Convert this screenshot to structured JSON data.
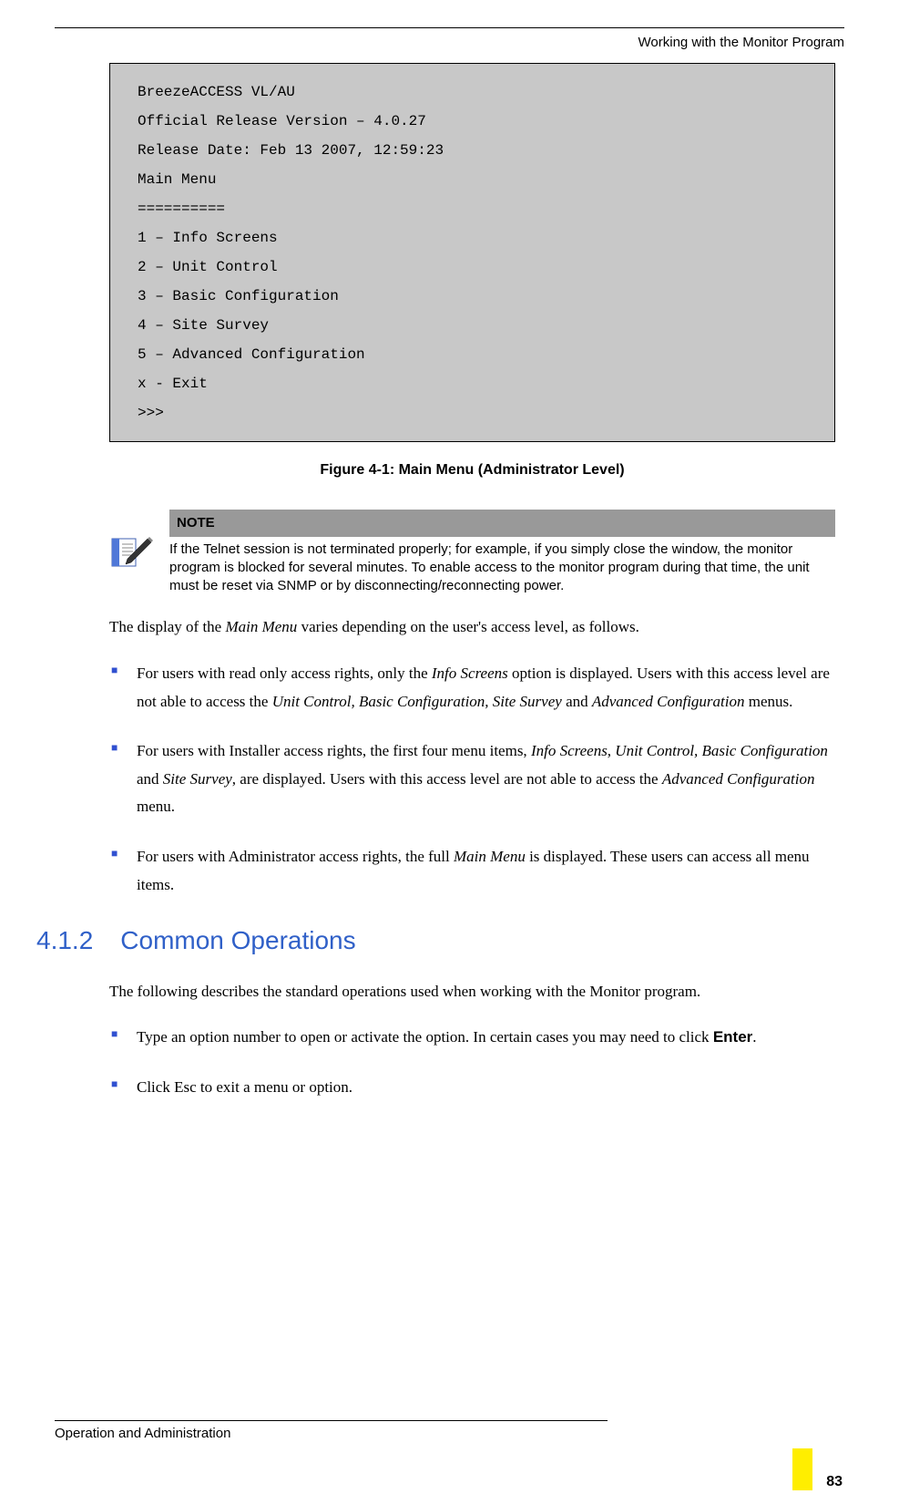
{
  "header": {
    "running_title": "Working with the Monitor Program"
  },
  "terminal": {
    "lines": [
      "BreezeACCESS VL/AU",
      "Official Release Version – 4.0.27",
      "Release Date: Feb 13 2007, 12:59:23",
      "Main Menu",
      "==========",
      "1 –  Info Screens",
      "2 – Unit Control",
      "3 –  Basic Configuration",
      "4 – Site Survey",
      "5 – Advanced Configuration",
      "x - Exit",
      ">>>"
    ]
  },
  "figure_caption": "Figure 4-1: Main Menu (Administrator Level)",
  "note": {
    "label": "NOTE",
    "text": "If the Telnet session is not terminated properly; for example, if you simply close the window, the monitor program is blocked for several minutes. To enable access to the monitor program during that time, the unit must be reset via SNMP or by disconnecting/reconnecting power."
  },
  "body": {
    "intro_pre": "The display of the ",
    "intro_em": "Main Menu",
    "intro_post": " varies depending on the user's access level, as follows.",
    "bullets": [
      {
        "parts": [
          {
            "t": " For users with read only access rights, only the "
          },
          {
            "t": "Info Screens",
            "em": true
          },
          {
            "t": " option is displayed. Users with this access level are not able to access the "
          },
          {
            "t": "Unit Control, Basic Configuration, Site Survey",
            "em": true
          },
          {
            "t": " and "
          },
          {
            "t": "Advanced Configuration",
            "em": true
          },
          {
            "t": " menus."
          }
        ]
      },
      {
        "parts": [
          {
            "t": " For users with Installer access rights, the first four menu items, "
          },
          {
            "t": "Info Screens, Unit Control, Basic Configuration",
            "em": true
          },
          {
            "t": " and "
          },
          {
            "t": "Site Survey",
            "em": true
          },
          {
            "t": ", are displayed. Users with this access level are not able to access the "
          },
          {
            "t": "Advanced Configuration",
            "em": true
          },
          {
            "t": " menu."
          }
        ]
      },
      {
        "parts": [
          {
            "t": " For users with Administrator access rights, the full "
          },
          {
            "t": "Main Menu",
            "em": true
          },
          {
            "t": " is displayed. These users can access all menu items."
          }
        ]
      }
    ]
  },
  "section": {
    "num": "4.1.2",
    "title": "Common Operations",
    "intro": "The following describes the standard operations used when working with the Monitor program.",
    "bullets": [
      {
        "parts": [
          {
            "t": " Type an option number to open or activate the option. In certain cases you may need to click "
          },
          {
            "t": "Enter",
            "bold": true
          },
          {
            "t": "."
          }
        ]
      },
      {
        "parts": [
          {
            "t": " Click Esc to exit a menu or option."
          }
        ]
      }
    ]
  },
  "footer": {
    "text": "Operation and Administration",
    "page": "83"
  }
}
